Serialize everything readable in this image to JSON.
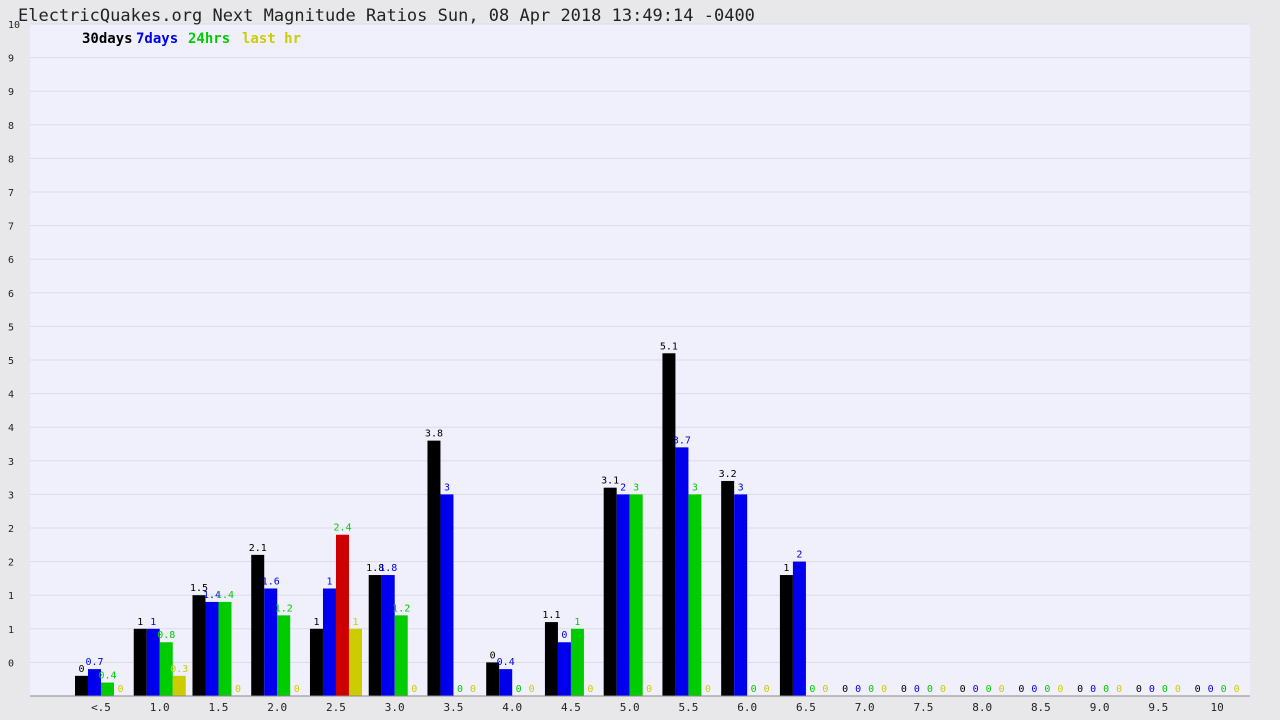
{
  "chart_data": {
    "type": "bar",
    "title": "ElectricQuakes.org Next Magnitude Ratios Sun, 08 Apr 2018 13:49:14 -0400",
    "xlabel": "",
    "ylabel": "",
    "ylim": [
      0,
      10
    ],
    "y_ticks": [
      "0",
      "1",
      "1",
      "2",
      "2",
      "3",
      "3",
      "4",
      "4",
      "5",
      "5",
      "6",
      "6",
      "7",
      "7",
      "8",
      "8",
      "9",
      "9",
      "10"
    ],
    "grid": true,
    "legend_position": "top-left",
    "categories": [
      "<.5",
      "1.0",
      "1.5",
      "2.0",
      "2.5",
      "3.0",
      "3.5",
      "4.0",
      "4.5",
      "5.0",
      "5.5",
      "6.0",
      "6.5",
      "7.0",
      "7.5",
      "8.0",
      "8.5",
      "9.0",
      "9.5",
      "10"
    ],
    "series": [
      {
        "name": "30days",
        "color": "#000000",
        "values": [
          0.3,
          1,
          1.5,
          2.1,
          1,
          1.8,
          3.8,
          0.5,
          1.1,
          3.1,
          5.1,
          3.2,
          1.8,
          0,
          0,
          0,
          0,
          0,
          0,
          0
        ],
        "labels": [
          "0",
          "1",
          "1.5",
          "2.1",
          "1",
          "1.8",
          "3.8",
          "0",
          "1.1",
          "3.1",
          "5.1",
          "3.2",
          "1",
          "0",
          "0",
          "0",
          "0",
          "0",
          "0",
          "0"
        ]
      },
      {
        "name": "7days",
        "color": "#0000ee",
        "values": [
          0.4,
          1,
          1.4,
          1.6,
          1.6,
          1.8,
          3,
          0.4,
          0.8,
          3,
          3.7,
          3,
          2,
          0,
          0,
          0,
          0,
          0,
          0,
          0
        ],
        "labels": [
          "0.7",
          "1",
          "1.4",
          "1.6",
          "1",
          "1.8",
          "3",
          "0.4",
          "0",
          "2",
          "3.7",
          "3",
          "2",
          "0",
          "0",
          "0",
          "0",
          "0",
          "0",
          "0"
        ]
      },
      {
        "name": "24hrs",
        "color": "#00cc00",
        "values": [
          0.2,
          0.8,
          1.4,
          1.2,
          2.4,
          1.2,
          0,
          0,
          1,
          3,
          3,
          0,
          0,
          0,
          0,
          0,
          0,
          0,
          0,
          0
        ],
        "labels": [
          "0.4",
          "0.8",
          "1.4",
          "1.2",
          "2.4",
          "1.2",
          "0",
          "0",
          "1",
          "3",
          "3",
          "0",
          "0",
          "0",
          "0",
          "0",
          "0",
          "0",
          "0",
          "0"
        ]
      },
      {
        "name": "last hr",
        "color": "#cccc00",
        "values": [
          0,
          0.3,
          0,
          0,
          1,
          0,
          0,
          0,
          0,
          0,
          0,
          0,
          0,
          0,
          0,
          0,
          0,
          0,
          0,
          0
        ],
        "labels": [
          "0",
          "0.3",
          "0",
          "0",
          "1",
          "0",
          "0",
          "0",
          "0",
          "0",
          "0",
          "0",
          "0",
          "0",
          "0",
          "0",
          "0",
          "0",
          "0",
          "0"
        ]
      }
    ],
    "highlight": {
      "category": "2.5",
      "series": "24hrs",
      "color": "#cc0000"
    }
  }
}
